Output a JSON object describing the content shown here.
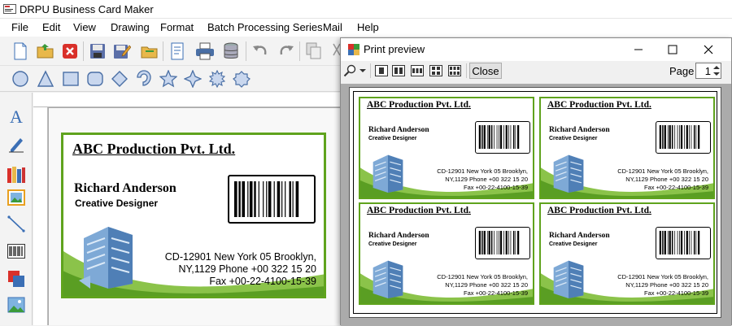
{
  "window": {
    "title": "DRPU Business Card Maker"
  },
  "menu": {
    "items": [
      "File",
      "Edit",
      "View",
      "Drawing",
      "Format",
      "Batch Processing Series",
      "Mail",
      "Help"
    ]
  },
  "card": {
    "company": "ABC Production Pvt. Ltd.",
    "name": "Richard Anderson",
    "role": "Creative Designer",
    "address_line1": "CD-12901 New York 05 Brooklyn,",
    "address_line2": "NY,1129  Phone +00 322 15 20",
    "address_line3": "Fax +00-22-4100-15-39"
  },
  "preview": {
    "title": "Print preview",
    "close_label": "Close",
    "page_label": "Page",
    "page_value": "1"
  },
  "colors": {
    "card_border": "#5fa31d",
    "canvas_bg": "#ababab"
  },
  "icons": {
    "toolbar": [
      "new-file-icon",
      "open-folder-icon",
      "close-red-icon",
      "save-icon",
      "save-as-icon",
      "open-icon",
      "page-setup-icon",
      "print-icon",
      "database-icon",
      "undo-icon",
      "redo-icon",
      "copy-icon",
      "cut-icon"
    ],
    "shapes": [
      "ellipse-icon",
      "triangle-icon",
      "rectangle-icon",
      "rounded-rectangle-icon",
      "diamond-icon",
      "arc-icon",
      "star-icon",
      "four-point-star-icon",
      "starburst-icon",
      "polygon-burst-icon"
    ],
    "left_tools": [
      "text-tool-icon",
      "pen-tool-icon",
      "library-icon",
      "image-icon",
      "line-tool-icon",
      "barcode-tool-icon",
      "shapes-tool-icon",
      "picture-tool-icon"
    ]
  }
}
